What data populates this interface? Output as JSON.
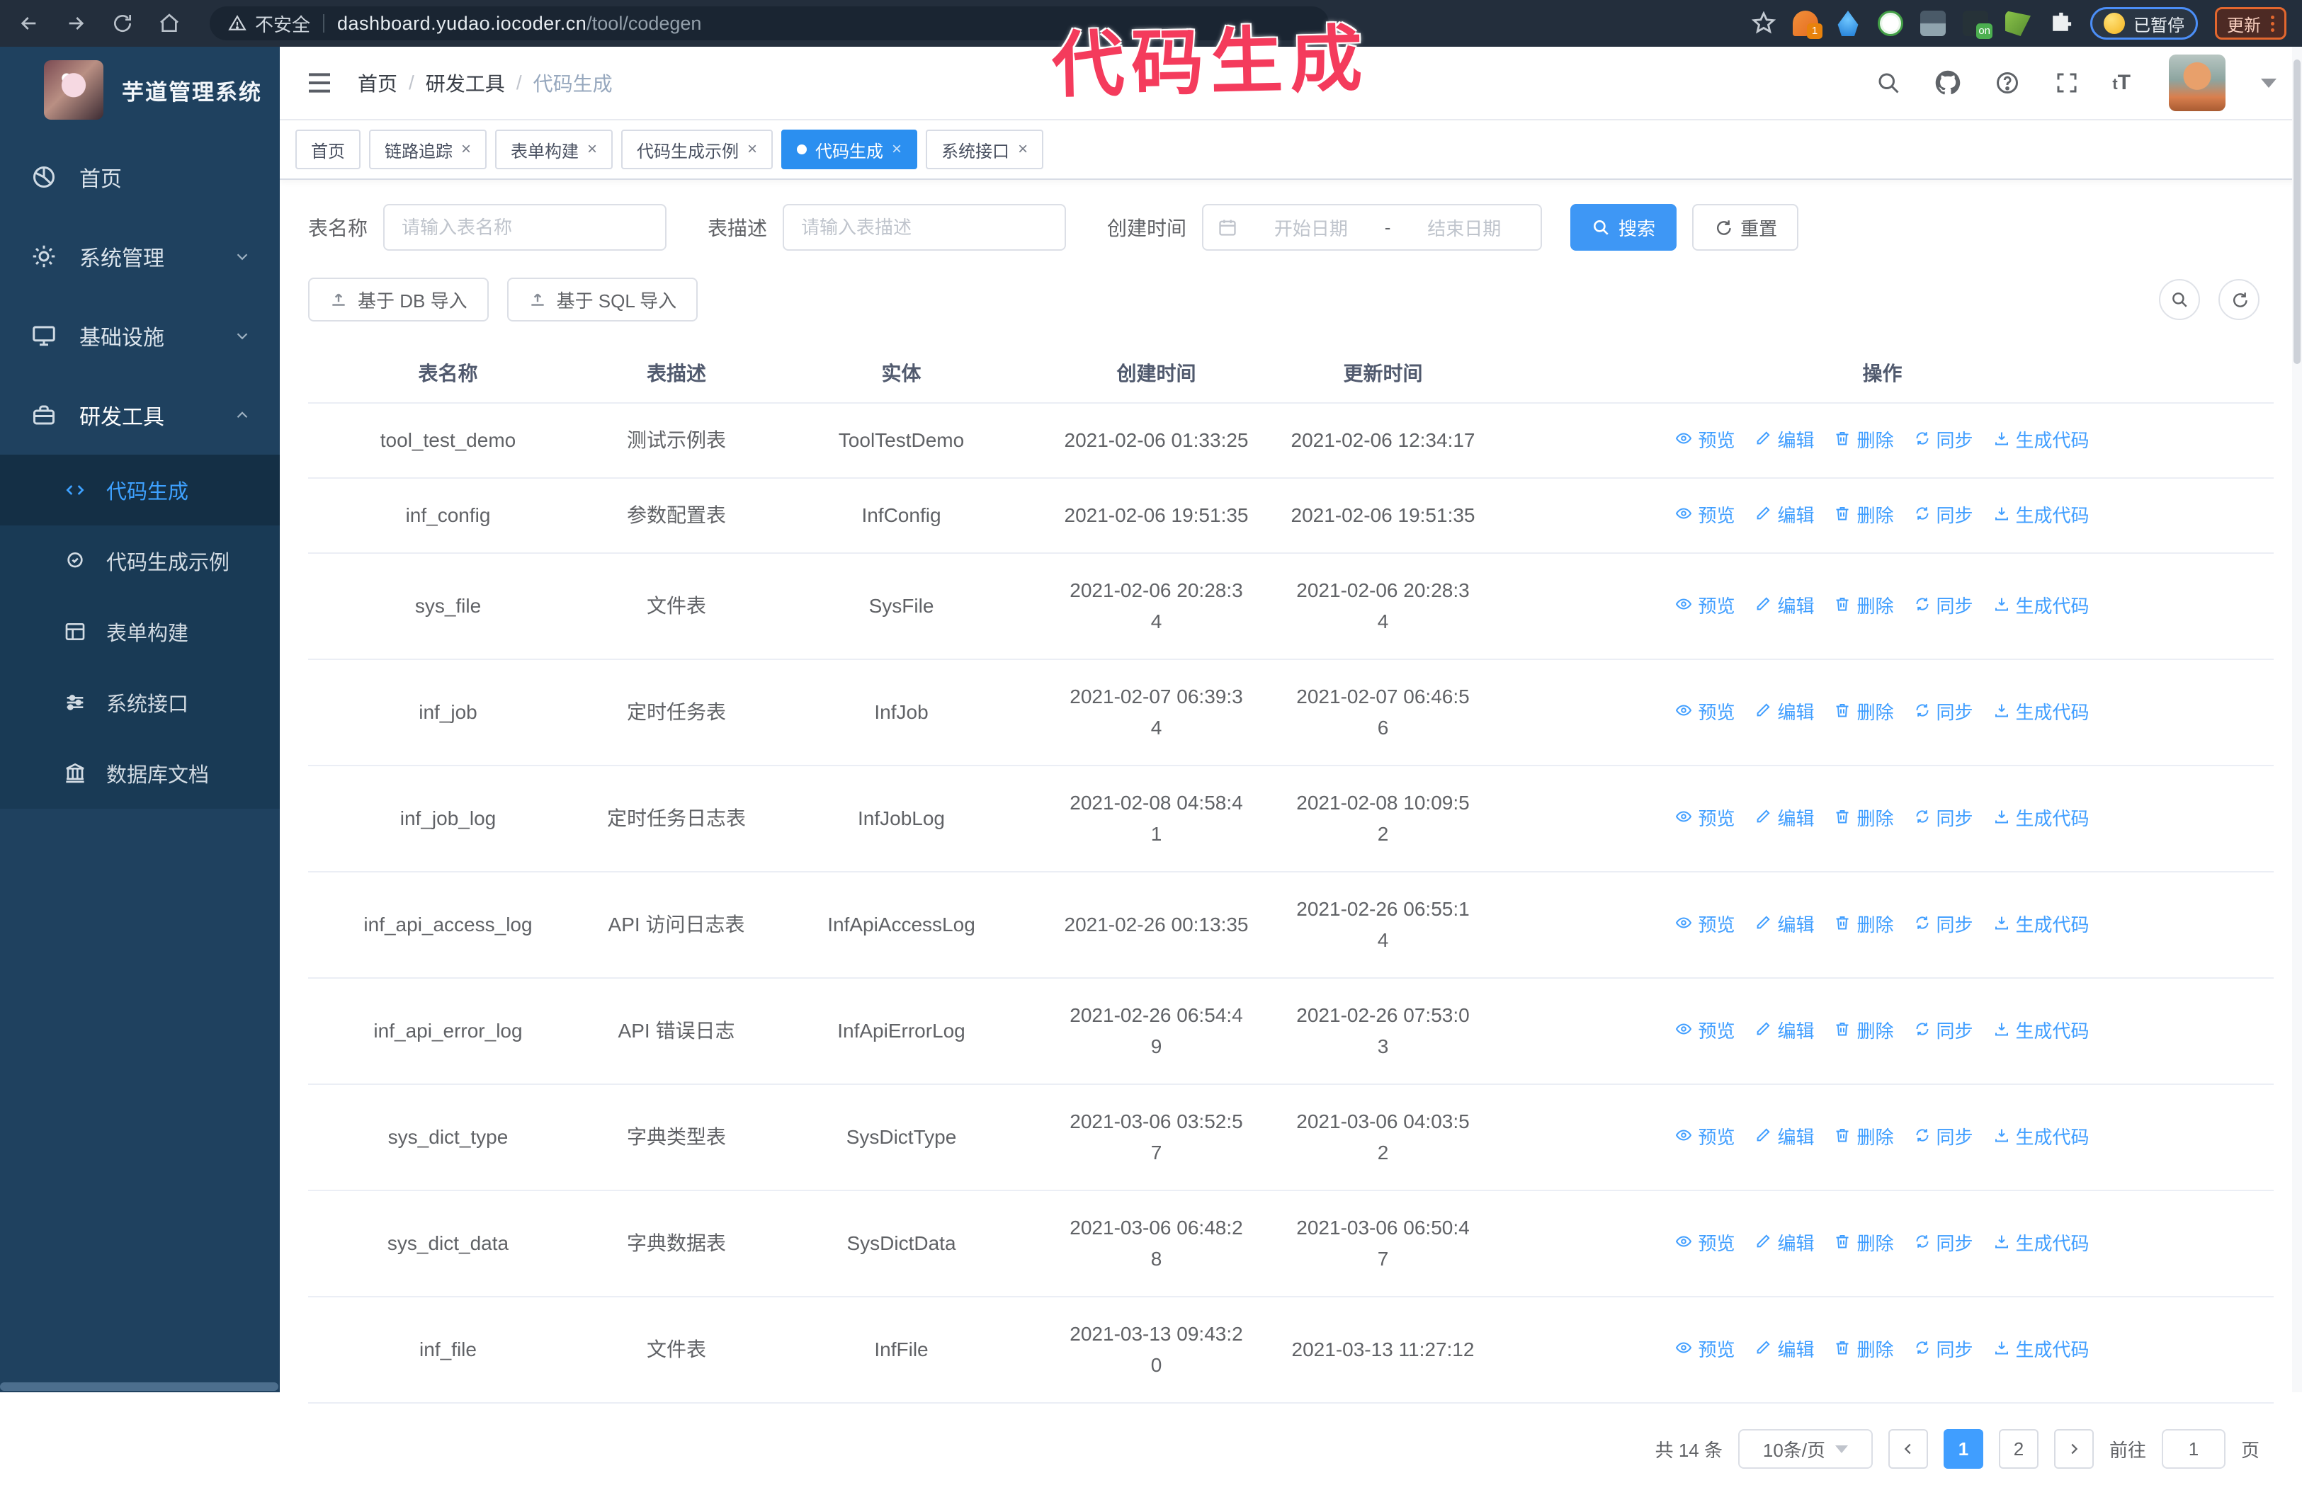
{
  "browser": {
    "security_text": "不安全",
    "url_host": "dashboard.yudao.iocoder.cn",
    "url_path": "/tool/codegen",
    "ext_badge_1": "1",
    "ext_badge_on": "on",
    "paused_label": "已暂停",
    "update_label": "更新"
  },
  "annotation": {
    "text": "代码生成"
  },
  "sidebar": {
    "title": "芋道管理系统",
    "items": [
      {
        "label": "首页",
        "icon": "home",
        "chevron": "",
        "active": false
      },
      {
        "label": "系统管理",
        "icon": "gear",
        "chevron": "down",
        "active": false
      },
      {
        "label": "基础设施",
        "icon": "monitor",
        "chevron": "down",
        "active": false
      },
      {
        "label": "研发工具",
        "icon": "toolbox",
        "chevron": "up",
        "active": true
      }
    ],
    "subitems": [
      {
        "label": "代码生成",
        "icon": "code",
        "active": true
      },
      {
        "label": "代码生成示例",
        "icon": "badge-check",
        "active": false
      },
      {
        "label": "表单构建",
        "icon": "form",
        "active": false
      },
      {
        "label": "系统接口",
        "icon": "sliders",
        "active": false
      },
      {
        "label": "数据库文档",
        "icon": "columns",
        "active": false
      }
    ]
  },
  "header": {
    "breadcrumb": [
      "首页",
      "研发工具",
      "代码生成"
    ],
    "breadcrumb_separator": "/"
  },
  "tabs": [
    {
      "label": "首页",
      "closable": false,
      "active": false
    },
    {
      "label": "链路追踪",
      "closable": true,
      "active": false
    },
    {
      "label": "表单构建",
      "closable": true,
      "active": false
    },
    {
      "label": "代码生成示例",
      "closable": true,
      "active": false
    },
    {
      "label": "代码生成",
      "closable": true,
      "active": true
    },
    {
      "label": "系统接口",
      "closable": true,
      "active": false
    }
  ],
  "filters": {
    "name_label": "表名称",
    "name_placeholder": "请输入表名称",
    "desc_label": "表描述",
    "desc_placeholder": "请输入表描述",
    "time_label": "创建时间",
    "start_placeholder": "开始日期",
    "range_separator": "-",
    "end_placeholder": "结束日期",
    "search_label": "搜索",
    "reset_label": "重置"
  },
  "toolbar": {
    "import_db_label": "基于 DB 导入",
    "import_sql_label": "基于 SQL 导入"
  },
  "table": {
    "columns": [
      "表名称",
      "表描述",
      "实体",
      "创建时间",
      "更新时间",
      "操作"
    ],
    "actions": [
      {
        "label": "预览",
        "icon": "eye"
      },
      {
        "label": "编辑",
        "icon": "edit"
      },
      {
        "label": "删除",
        "icon": "trash"
      },
      {
        "label": "同步",
        "icon": "sync"
      },
      {
        "label": "生成代码",
        "icon": "download"
      }
    ],
    "rows": [
      {
        "name": "tool_test_demo",
        "desc": "测试示例表",
        "entity": "ToolTestDemo",
        "created": "2021-02-06 01:33:25",
        "updated": "2021-02-06 12:34:17"
      },
      {
        "name": "inf_config",
        "desc": "参数配置表",
        "entity": "InfConfig",
        "created": "2021-02-06 19:51:35",
        "updated": "2021-02-06 19:51:35"
      },
      {
        "name": "sys_file",
        "desc": "文件表",
        "entity": "SysFile",
        "created": "2021-02-06 20:28:3\n4",
        "updated": "2021-02-06 20:28:3\n4"
      },
      {
        "name": "inf_job",
        "desc": "定时任务表",
        "entity": "InfJob",
        "created": "2021-02-07 06:39:3\n4",
        "updated": "2021-02-07 06:46:5\n6"
      },
      {
        "name": "inf_job_log",
        "desc": "定时任务日志表",
        "entity": "InfJobLog",
        "created": "2021-02-08 04:58:4\n1",
        "updated": "2021-02-08 10:09:5\n2"
      },
      {
        "name": "inf_api_access_log",
        "desc": "API 访问日志表",
        "entity": "InfApiAccessLog",
        "created": "2021-02-26 00:13:35",
        "updated": "2021-02-26 06:55:1\n4"
      },
      {
        "name": "inf_api_error_log",
        "desc": "API 错误日志",
        "entity": "InfApiErrorLog",
        "created": "2021-02-26 06:54:4\n9",
        "updated": "2021-02-26 07:53:0\n3"
      },
      {
        "name": "sys_dict_type",
        "desc": "字典类型表",
        "entity": "SysDictType",
        "created": "2021-03-06 03:52:5\n7",
        "updated": "2021-03-06 04:03:5\n2"
      },
      {
        "name": "sys_dict_data",
        "desc": "字典数据表",
        "entity": "SysDictData",
        "created": "2021-03-06 06:48:2\n8",
        "updated": "2021-03-06 06:50:4\n7"
      },
      {
        "name": "inf_file",
        "desc": "文件表",
        "entity": "InfFile",
        "created": "2021-03-13 09:43:2\n0",
        "updated": "2021-03-13 11:27:12"
      }
    ]
  },
  "pagination": {
    "total": "共 14 条",
    "page_size": "10条/页",
    "pages": [
      "1",
      "2"
    ],
    "active_page": "1",
    "goto_label": "前往",
    "goto_value": "1",
    "page_label": "页"
  },
  "colors": {
    "accent_blue": "#409eff",
    "active_tab_blue": "#2b8ff0",
    "sidebar_bg": "#1f415f",
    "submenu_bg": "#193a55",
    "chrome_bg": "#232e3c",
    "annotation_pink": "#f43b5c",
    "update_button_border": "#e3672e",
    "paused_pill_border": "#4b8ef7"
  }
}
